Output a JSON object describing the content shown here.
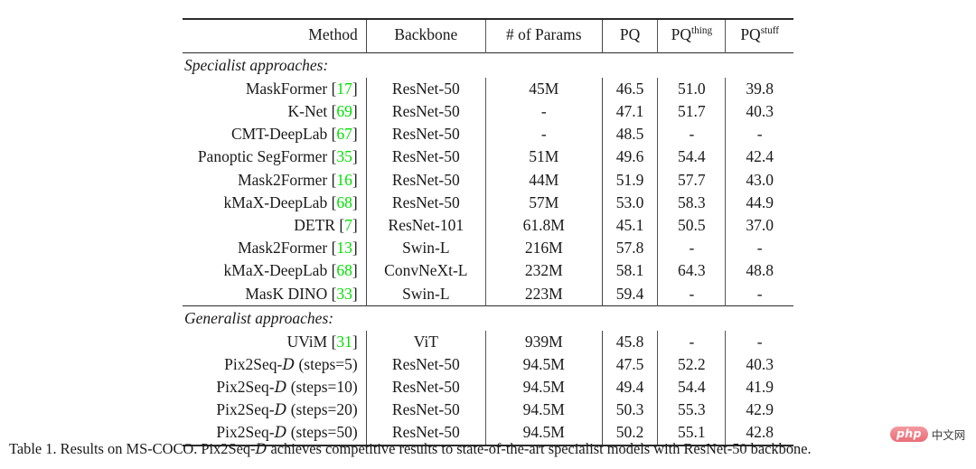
{
  "table": {
    "columns": [
      {
        "key": "method",
        "label": "Method"
      },
      {
        "key": "backbone",
        "label": "Backbone"
      },
      {
        "key": "params",
        "label": "# of Params"
      },
      {
        "key": "pq",
        "label": "PQ"
      },
      {
        "key": "pq_thing",
        "label": "PQ",
        "sup": "thing"
      },
      {
        "key": "pq_stuff",
        "label": "PQ",
        "sup": "stuff"
      }
    ],
    "sections": [
      {
        "label": "Specialist approaches:",
        "rows": [
          {
            "method": "MaskFormer",
            "cite": "17",
            "backbone": "ResNet-50",
            "params": "45M",
            "pq": "46.5",
            "pq_thing": "51.0",
            "pq_stuff": "39.8"
          },
          {
            "method": "K-Net",
            "cite": "69",
            "backbone": "ResNet-50",
            "params": "-",
            "pq": "47.1",
            "pq_thing": "51.7",
            "pq_stuff": "40.3"
          },
          {
            "method": "CMT-DeepLab",
            "cite": "67",
            "backbone": "ResNet-50",
            "params": "-",
            "pq": "48.5",
            "pq_thing": "-",
            "pq_stuff": "-"
          },
          {
            "method": "Panoptic SegFormer",
            "cite": "35",
            "backbone": "ResNet-50",
            "params": "51M",
            "pq": "49.6",
            "pq_thing": "54.4",
            "pq_stuff": "42.4"
          },
          {
            "method": "Mask2Former",
            "cite": "16",
            "backbone": "ResNet-50",
            "params": "44M",
            "pq": "51.9",
            "pq_thing": "57.7",
            "pq_stuff": "43.0"
          },
          {
            "method": "kMaX-DeepLab",
            "cite": "68",
            "backbone": "ResNet-50",
            "params": "57M",
            "pq": "53.0",
            "pq_thing": "58.3",
            "pq_stuff": "44.9"
          },
          {
            "method": "DETR",
            "cite": "7",
            "backbone": "ResNet-101",
            "params": "61.8M",
            "pq": "45.1",
            "pq_thing": "50.5",
            "pq_stuff": "37.0"
          },
          {
            "method": "Mask2Former",
            "cite": "13",
            "backbone": "Swin-L",
            "params": "216M",
            "pq": "57.8",
            "pq_thing": "-",
            "pq_stuff": "-"
          },
          {
            "method": "kMaX-DeepLab",
            "cite": "68",
            "backbone": "ConvNeXt-L",
            "params": "232M",
            "pq": "58.1",
            "pq_thing": "64.3",
            "pq_stuff": "48.8"
          },
          {
            "method": "MasK DINO",
            "cite": "33",
            "backbone": "Swin-L",
            "params": "223M",
            "pq": "59.4",
            "pq_thing": "-",
            "pq_stuff": "-"
          }
        ]
      },
      {
        "label": "Generalist approaches:",
        "rows": [
          {
            "method": "UViM",
            "cite": "31",
            "backbone": "ViT",
            "params": "939M",
            "pq": "45.8",
            "pq_thing": "-",
            "pq_stuff": "-"
          },
          {
            "method": "Pix2Seq-D (steps=5)",
            "script_d": true,
            "backbone": "ResNet-50",
            "params": "94.5M",
            "pq": "47.5",
            "pq_thing": "52.2",
            "pq_stuff": "40.3"
          },
          {
            "method": "Pix2Seq-D (steps=10)",
            "script_d": true,
            "backbone": "ResNet-50",
            "params": "94.5M",
            "pq": "49.4",
            "pq_thing": "54.4",
            "pq_stuff": "41.9"
          },
          {
            "method": "Pix2Seq-D (steps=20)",
            "script_d": true,
            "backbone": "ResNet-50",
            "params": "94.5M",
            "pq": "50.3",
            "pq_thing": "55.3",
            "pq_stuff": "42.9"
          },
          {
            "method": "Pix2Seq-D (steps=50)",
            "script_d": true,
            "backbone": "ResNet-50",
            "params": "94.5M",
            "pq": "50.2",
            "pq_thing": "55.1",
            "pq_stuff": "42.8"
          }
        ]
      }
    ]
  },
  "caption": {
    "number": "Table 1.",
    "text": "Results on MS-COCO. Pix2Seq-D achieves competitive results to state-of-the-art specialist models with ResNet-50 backbone."
  },
  "watermark": {
    "logo_text": "php",
    "site_text": "中文网",
    "logo_color": "#ef7f88"
  },
  "colors": {
    "citation_green": "#00e000",
    "rule_color": "#2a2a2a",
    "text": "#1a1a1a"
  }
}
